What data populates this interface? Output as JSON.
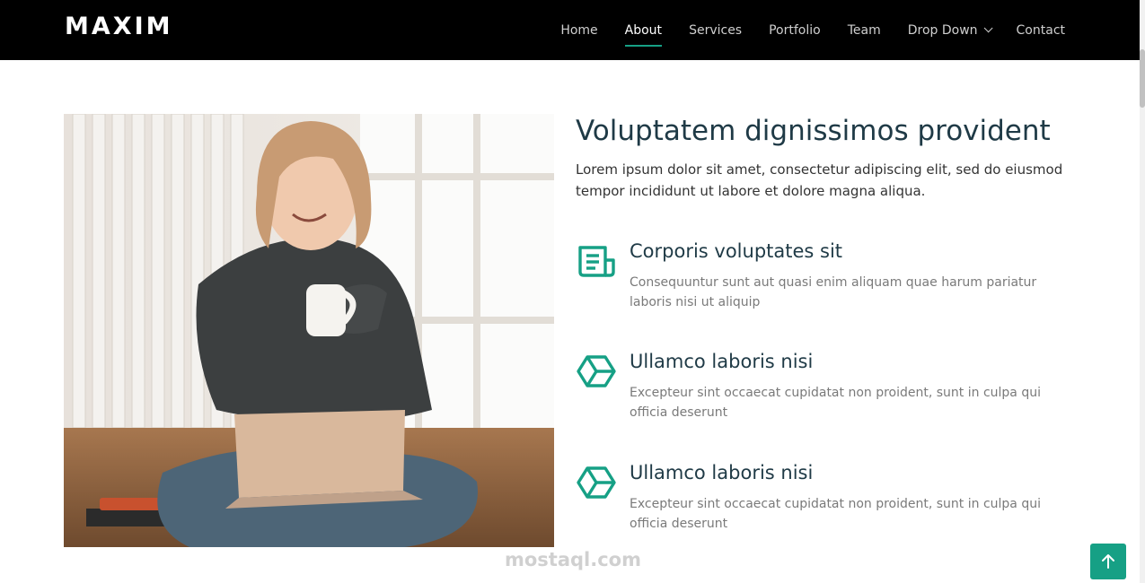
{
  "header": {
    "logo": "MAXIM",
    "nav": [
      {
        "label": "Home"
      },
      {
        "label": "About",
        "active": true
      },
      {
        "label": "Services"
      },
      {
        "label": "Portfolio"
      },
      {
        "label": "Team"
      },
      {
        "label": "Drop Down",
        "has_dropdown": true
      },
      {
        "label": "Contact"
      }
    ]
  },
  "about": {
    "title": "Voluptatem dignissimos provident",
    "lead": "Lorem ipsum dolor sit amet, consectetur adipiscing elit, sed do eiusmod tempor incididunt ut labore et dolore magna aliqua.",
    "features": [
      {
        "icon": "receipt-icon",
        "title": "Corporis voluptates sit",
        "desc": "Consequuntur sunt aut quasi enim aliquam quae harum pariatur laboris nisi ut aliquip"
      },
      {
        "icon": "cube-icon",
        "title": "Ullamco laboris nisi",
        "desc": "Excepteur sint occaecat cupidatat non proident, sunt in culpa qui officia deserunt"
      },
      {
        "icon": "cube-icon",
        "title": "Ullamco laboris nisi",
        "desc": "Excepteur sint occaecat cupidatat non proident, sunt in culpa qui officia deserunt"
      }
    ]
  },
  "watermark": {
    "text": "mostaql.com"
  },
  "colors": {
    "accent": "#16a085",
    "header_bg": "#000000",
    "heading": "#1f3a46"
  }
}
